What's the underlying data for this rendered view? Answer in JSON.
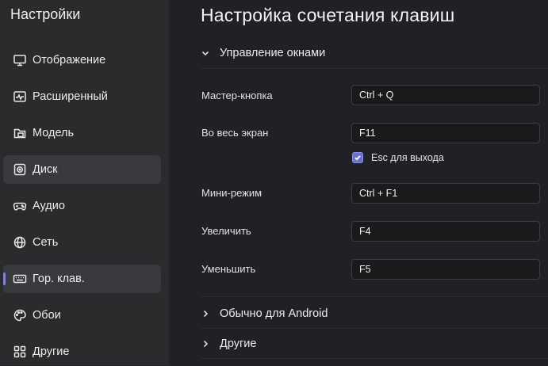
{
  "sidebar": {
    "title": "Настройки",
    "items": [
      {
        "label": "Отображение",
        "icon": "monitor-icon"
      },
      {
        "label": "Расширенный",
        "icon": "pulse-icon"
      },
      {
        "label": "Модель",
        "icon": "folder-icon"
      },
      {
        "label": "Диск",
        "icon": "disk-icon"
      },
      {
        "label": "Аудио",
        "icon": "gamepad-icon"
      },
      {
        "label": "Сеть",
        "icon": "globe-icon"
      },
      {
        "label": "Гор. клав.",
        "icon": "keyboard-icon"
      },
      {
        "label": "Обои",
        "icon": "palette-icon"
      },
      {
        "label": "Другие",
        "icon": "grid-icon"
      }
    ],
    "active_index": 6,
    "hover_index": 3
  },
  "main": {
    "title": "Настройка сочетания клавиш",
    "sections": {
      "window_management": "Управление окнами",
      "android_common": "Обычно для Android",
      "other": "Другие"
    },
    "rows": {
      "master_key": {
        "label": "Мастер-кнопка",
        "value": "Ctrl + Q"
      },
      "fullscreen": {
        "label": "Во весь экран",
        "value": "F11"
      },
      "esc_exit": {
        "label": "Esc для выхода",
        "checked": true
      },
      "mini_mode": {
        "label": "Мини-режим",
        "value": "Ctrl + F1"
      },
      "zoom_in": {
        "label": "Увеличить",
        "value": "F4"
      },
      "zoom_out": {
        "label": "Уменьшить",
        "value": "F5"
      }
    }
  },
  "colors": {
    "accent": "#7b83f0",
    "sidebar_bg": "#2b2b2e",
    "main_bg": "#202124",
    "checkbox": "#6a6fd6"
  }
}
